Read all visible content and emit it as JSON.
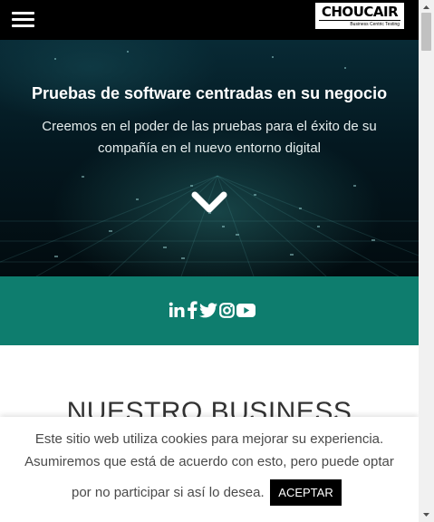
{
  "header": {
    "menu_icon": "hamburger-icon",
    "logo": {
      "name": "CHOUCAIR",
      "tagline": "Business Centric Testing"
    }
  },
  "hero": {
    "title": "Pruebas de software centradas en su negocio",
    "subtitle_line1": "Creemos en el poder de las pruebas para el éxito de su",
    "subtitle_line2": "compañía en el nuevo entorno digital",
    "scroll_icon": "chevron-down-icon"
  },
  "social": {
    "background": "#0e7d6e",
    "icons": [
      "linkedin-icon",
      "facebook-icon",
      "twitter-icon",
      "instagram-icon",
      "youtube-icon"
    ]
  },
  "section": {
    "title": "NUESTRO BUSINESS"
  },
  "cookie_banner": {
    "line1": "Este sitio web utiliza cookies para mejorar su experiencia.",
    "line2": "Asumiremos que está de acuerdo con esto, pero puede optar",
    "line3": "por no participar si así lo desea.",
    "accept_label": "ACEPTAR"
  },
  "colors": {
    "topbar": "#000000",
    "accent_teal": "#0e7d6e",
    "hero_dark": "#041820"
  }
}
